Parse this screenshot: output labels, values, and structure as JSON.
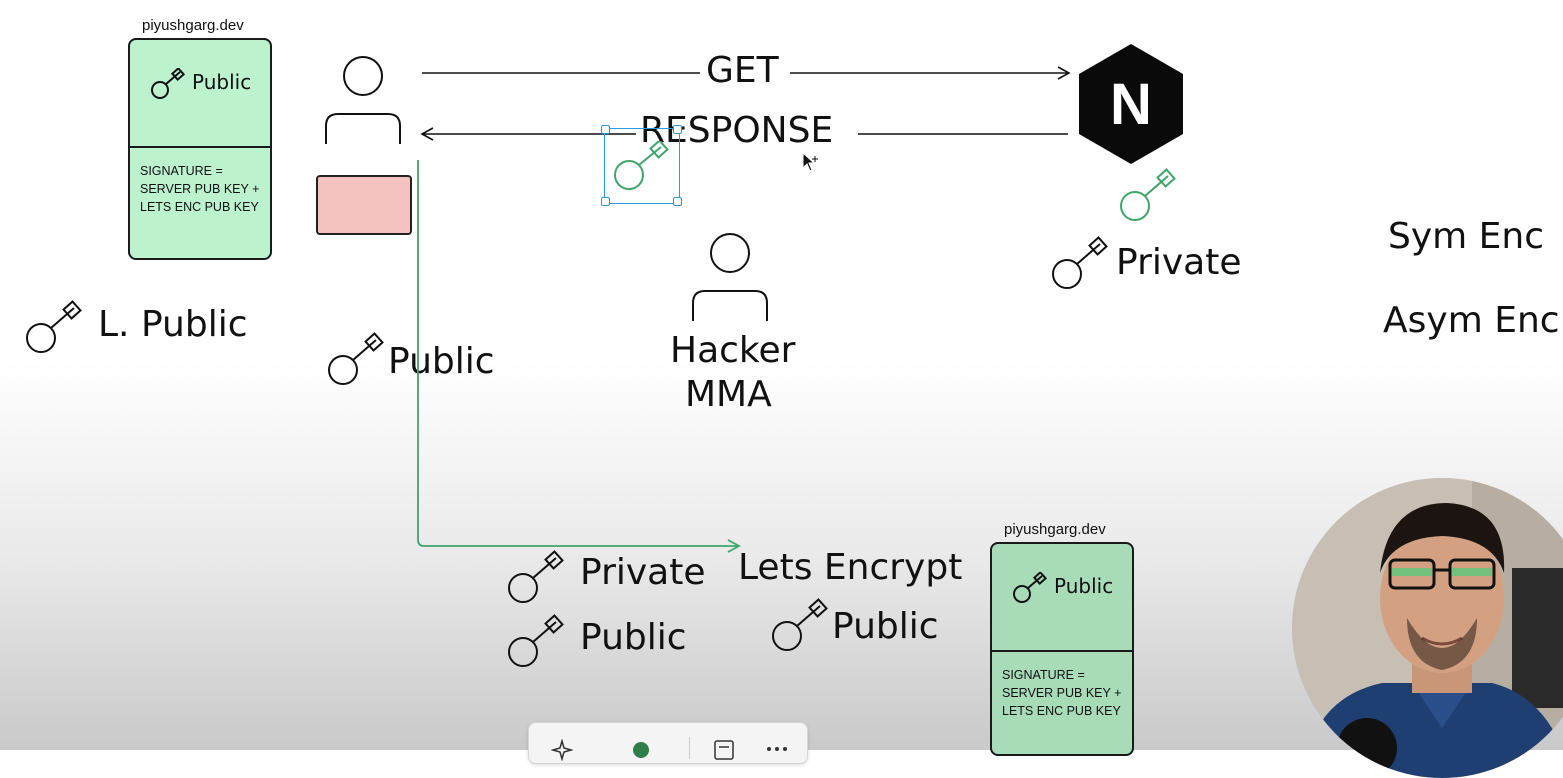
{
  "canvas": {
    "cert_top": {
      "domain": "piyushgarg.dev",
      "public_label": "Public",
      "signature_lines": [
        "SIGNATURE =",
        "SERVER PUB KEY +",
        "LETS ENC PUB KEY"
      ]
    },
    "cert_bottom": {
      "domain": "piyushgarg.dev",
      "public_label": "Public",
      "signature_lines": [
        "SIGNATURE =",
        "SERVER PUB KEY +",
        "LETS ENC PUB KEY"
      ]
    },
    "arrows": {
      "get_label": "GET",
      "response_label": "RESPONSE"
    },
    "labels": {
      "l_public": "L. Public",
      "client_public": "Public",
      "hacker_line1": "Hacker",
      "hacker_line2": "MMA",
      "server_private": "Private",
      "sym_enc": "Sym Enc",
      "asym_enc": "Asym Enc",
      "le_private": "Private",
      "le_public": "Public",
      "lets_encrypt": "Lets Encrypt",
      "lets_encrypt_public": "Public"
    },
    "server_logo_letter": "N",
    "colors": {
      "cert_fill": "#bdf2cf",
      "red_box": "#f5c2c2",
      "green_key": "#3fa66a",
      "selection": "#2c9be0",
      "server_hex": "#0a0a0a"
    }
  },
  "toolbar": {
    "icons": [
      "sparkle-icon",
      "color-dot-icon",
      "note-icon",
      "more-icon"
    ]
  }
}
